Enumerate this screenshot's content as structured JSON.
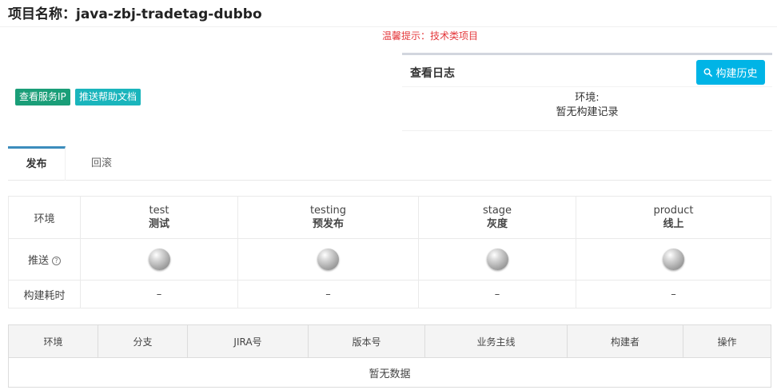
{
  "project": {
    "title": "项目名称：java-zbj-tradetag-dubbo"
  },
  "notice": "温馨提示：技术类项目",
  "buttons": {
    "service_ip": "查看服务IP",
    "push_doc": "推送帮助文档"
  },
  "log_panel": {
    "title": "查看日志",
    "history_button": "构建历史",
    "env_label": "环境:",
    "empty_text": "暂无构建记录"
  },
  "tabs": [
    {
      "label": "发布",
      "active": true
    },
    {
      "label": "回滚",
      "active": false
    }
  ],
  "env_table": {
    "row_labels": {
      "env": "环境",
      "push": "推送",
      "time": "构建耗时"
    },
    "help_icon": "question-circle-icon",
    "envs": [
      {
        "name": "test",
        "sub": "测试",
        "time": "–"
      },
      {
        "name": "testing",
        "sub": "预发布",
        "time": "–"
      },
      {
        "name": "stage",
        "sub": "灰度",
        "time": "–"
      },
      {
        "name": "product",
        "sub": "线上",
        "time": "–"
      }
    ]
  },
  "build_table": {
    "columns": [
      "环境",
      "分支",
      "JIRA号",
      "版本号",
      "业务主线",
      "构建者",
      "操作"
    ],
    "empty_text": "暂无数据"
  },
  "colors": {
    "notice_red": "#e4393c",
    "service_ip_green": "#1a9e78",
    "doc_teal": "#1ab5bc",
    "history_blue": "#00b4e6",
    "tab_active_border": "#3c8dbc"
  }
}
